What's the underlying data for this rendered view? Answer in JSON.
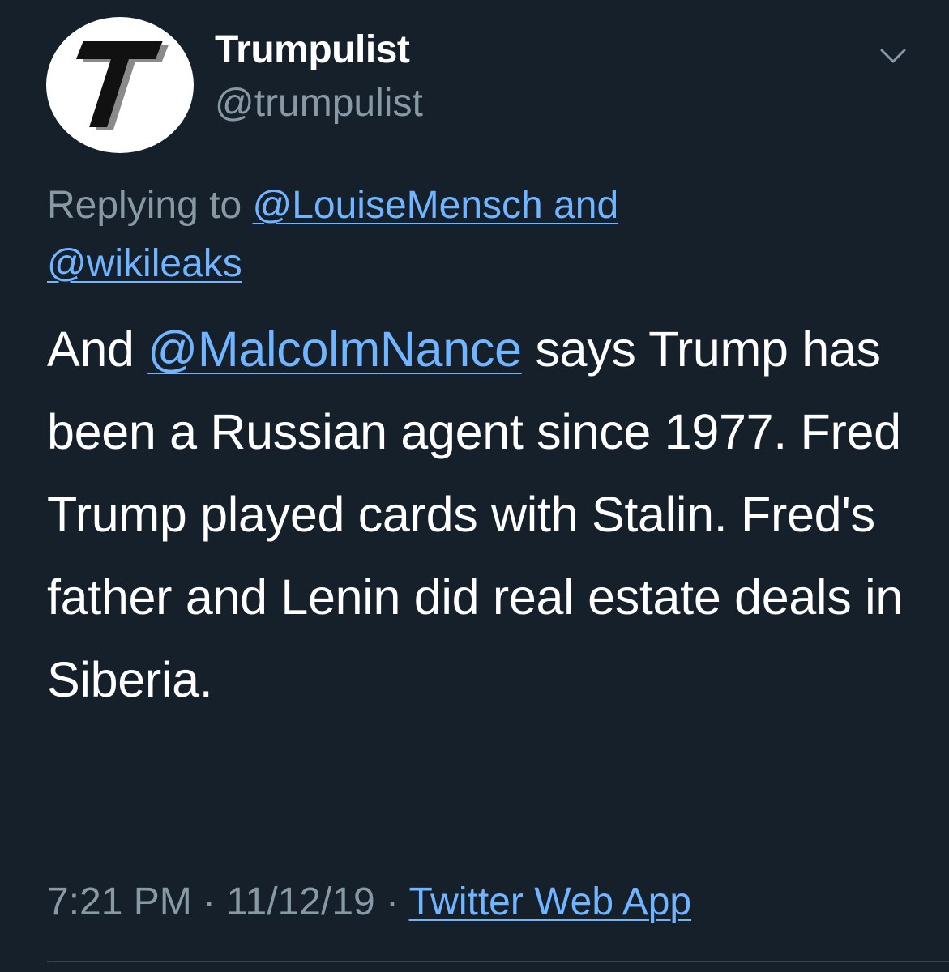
{
  "user": {
    "display_name": "Trumpulist",
    "handle": "@trumpulist",
    "avatar_letter": "T"
  },
  "reply": {
    "prefix": "Replying to",
    "mention_1": "@LouiseMensch and",
    "mention_2": "@wikileaks"
  },
  "tweet": {
    "text_start": "And ",
    "mention": "@MalcolmNance",
    "text_rest": " says Trump has been a Russian agent since 1977.  Fred Trump played cards with Stalin.  Fred's father and Lenin did real estate deals in Siberia."
  },
  "meta": {
    "time": "7:21 PM",
    "separator_1": " · ",
    "date": "11/12/19",
    "separator_2": " · ",
    "source": "Twitter Web App"
  },
  "icons": {
    "more": "chevron-down-icon"
  },
  "colors": {
    "background": "#15202b",
    "text": "#ffffff",
    "secondary": "#8899a6",
    "link": "#71b4ff"
  }
}
